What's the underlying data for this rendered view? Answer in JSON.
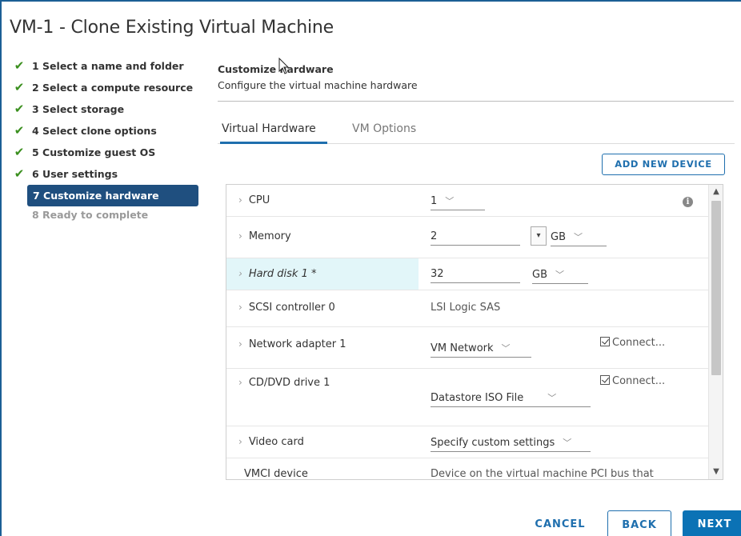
{
  "dialog": {
    "title": "VM-1 - Clone Existing Virtual Machine"
  },
  "steps": [
    {
      "label": "1 Select a name and folder",
      "state": "done"
    },
    {
      "label": "2 Select a compute resource",
      "state": "done"
    },
    {
      "label": "3 Select storage",
      "state": "done"
    },
    {
      "label": "4 Select clone options",
      "state": "done"
    },
    {
      "label": "5 Customize guest OS",
      "state": "done"
    },
    {
      "label": "6 User settings",
      "state": "done"
    },
    {
      "label": "7 Customize hardware",
      "state": "active"
    },
    {
      "label": "8 Ready to complete",
      "state": "pending"
    }
  ],
  "section": {
    "title": "Customize hardware",
    "subtitle": "Configure the virtual machine hardware"
  },
  "tabs": [
    {
      "label": "Virtual Hardware",
      "selected": true
    },
    {
      "label": "VM Options",
      "selected": false
    }
  ],
  "add_device_label": "ADD NEW DEVICE",
  "hardware": {
    "cpu": {
      "label": "CPU",
      "value": "1"
    },
    "memory": {
      "label": "Memory",
      "value": "2",
      "unit": "GB"
    },
    "hard_disk": {
      "label": "Hard disk 1 *",
      "value": "32",
      "unit": "GB"
    },
    "scsi": {
      "label": "SCSI controller 0",
      "value": "LSI Logic SAS"
    },
    "network": {
      "label": "Network adapter 1",
      "value": "VM Network",
      "connect": "Connect..."
    },
    "cddvd": {
      "label": "CD/DVD drive 1",
      "value": "Datastore ISO File",
      "connect": "Connect..."
    },
    "video": {
      "label": "Video card",
      "value": "Specify custom settings"
    },
    "vmci": {
      "label": "VMCI device",
      "value": "Device on the virtual machine PCI bus that"
    }
  },
  "footer": {
    "cancel": "CANCEL",
    "back": "BACK",
    "next": "NEXT"
  },
  "colors": {
    "accent": "#1f6fae",
    "active_step_bg": "#1f4f7f",
    "check_green": "#3a8f1e",
    "highlight_row": "#e2f6f9"
  }
}
